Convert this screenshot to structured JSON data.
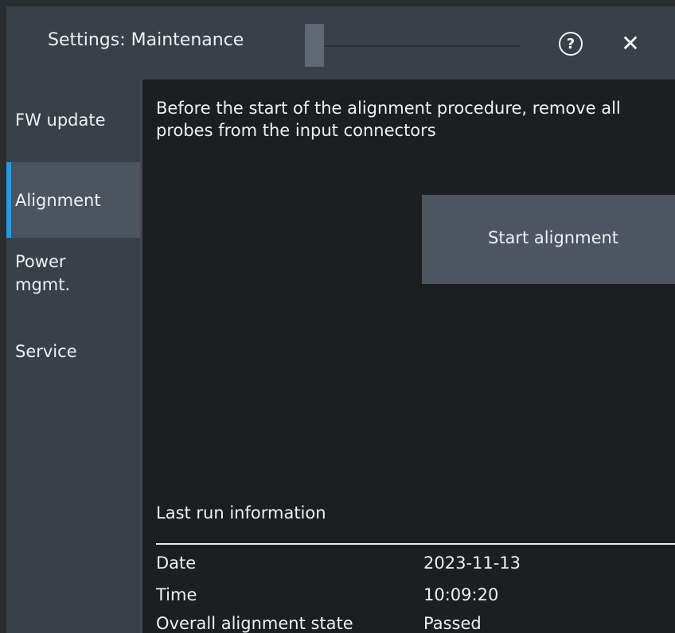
{
  "window": {
    "title": "Settings: Maintenance",
    "help_glyph": "?",
    "close_glyph": "✕"
  },
  "sidebar": {
    "items": [
      {
        "label": "FW update",
        "active": false
      },
      {
        "label": "Alignment",
        "active": true
      },
      {
        "label": "Power mgmt.",
        "active": false
      },
      {
        "label": "Service",
        "active": false
      }
    ]
  },
  "main": {
    "instruction": "Before the start of the alignment procedure, remove all probes from the input connectors",
    "start_button": "Start alignment",
    "last_run": {
      "title": "Last run information",
      "rows": [
        {
          "label": "Date",
          "value": "2023-11-13"
        },
        {
          "label": "Time",
          "value": "10:09:20"
        },
        {
          "label": "Overall alignment state",
          "value": "Passed"
        }
      ]
    }
  },
  "colors": {
    "accent": "#1aa0f0",
    "titlebar": "#3a4047",
    "background": "#1c1f22"
  },
  "icons": [
    "help-icon",
    "close-icon"
  ]
}
